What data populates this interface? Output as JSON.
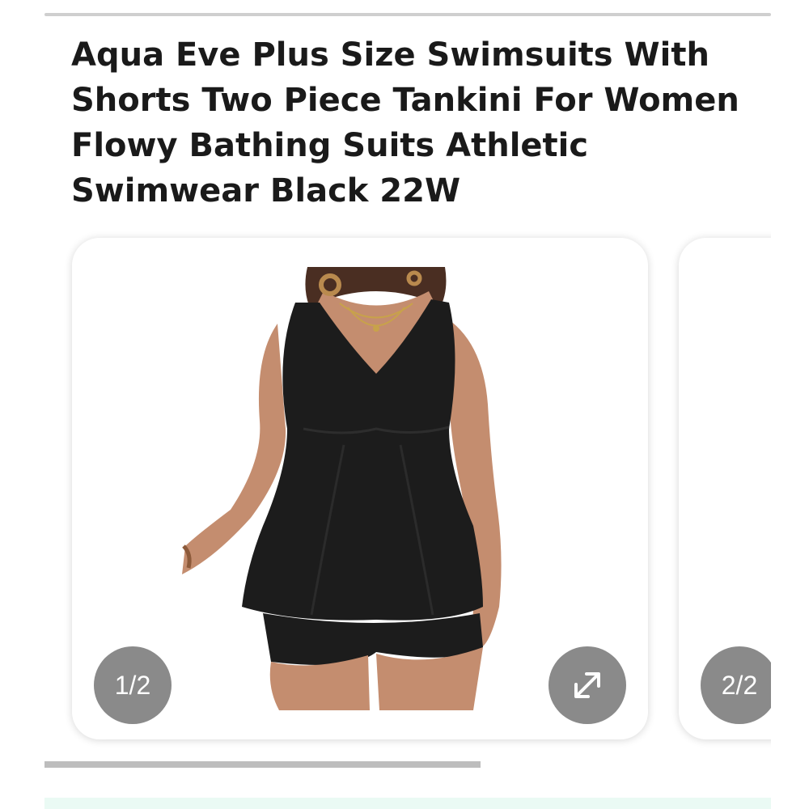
{
  "product": {
    "title": "Aqua Eve Plus Size Swimsuits With Shorts Two Piece Tankini For Women Flowy Bathing Suits Athletic Swimwear Black 22W"
  },
  "gallery": {
    "slides": [
      {
        "counter": "1/2",
        "image_icon": "product-photo-black-tankini"
      },
      {
        "counter": "2/2"
      }
    ],
    "current_slide": 1,
    "total_slides": 2,
    "expand_icon": "expand-arrows-icon",
    "scroll_progress": 0.6
  },
  "colors": {
    "badge_bg": "#8a8a8a",
    "title_text": "#1a1a1a",
    "swimsuit": "#1c1c1c",
    "skin": "#c48d6f"
  }
}
